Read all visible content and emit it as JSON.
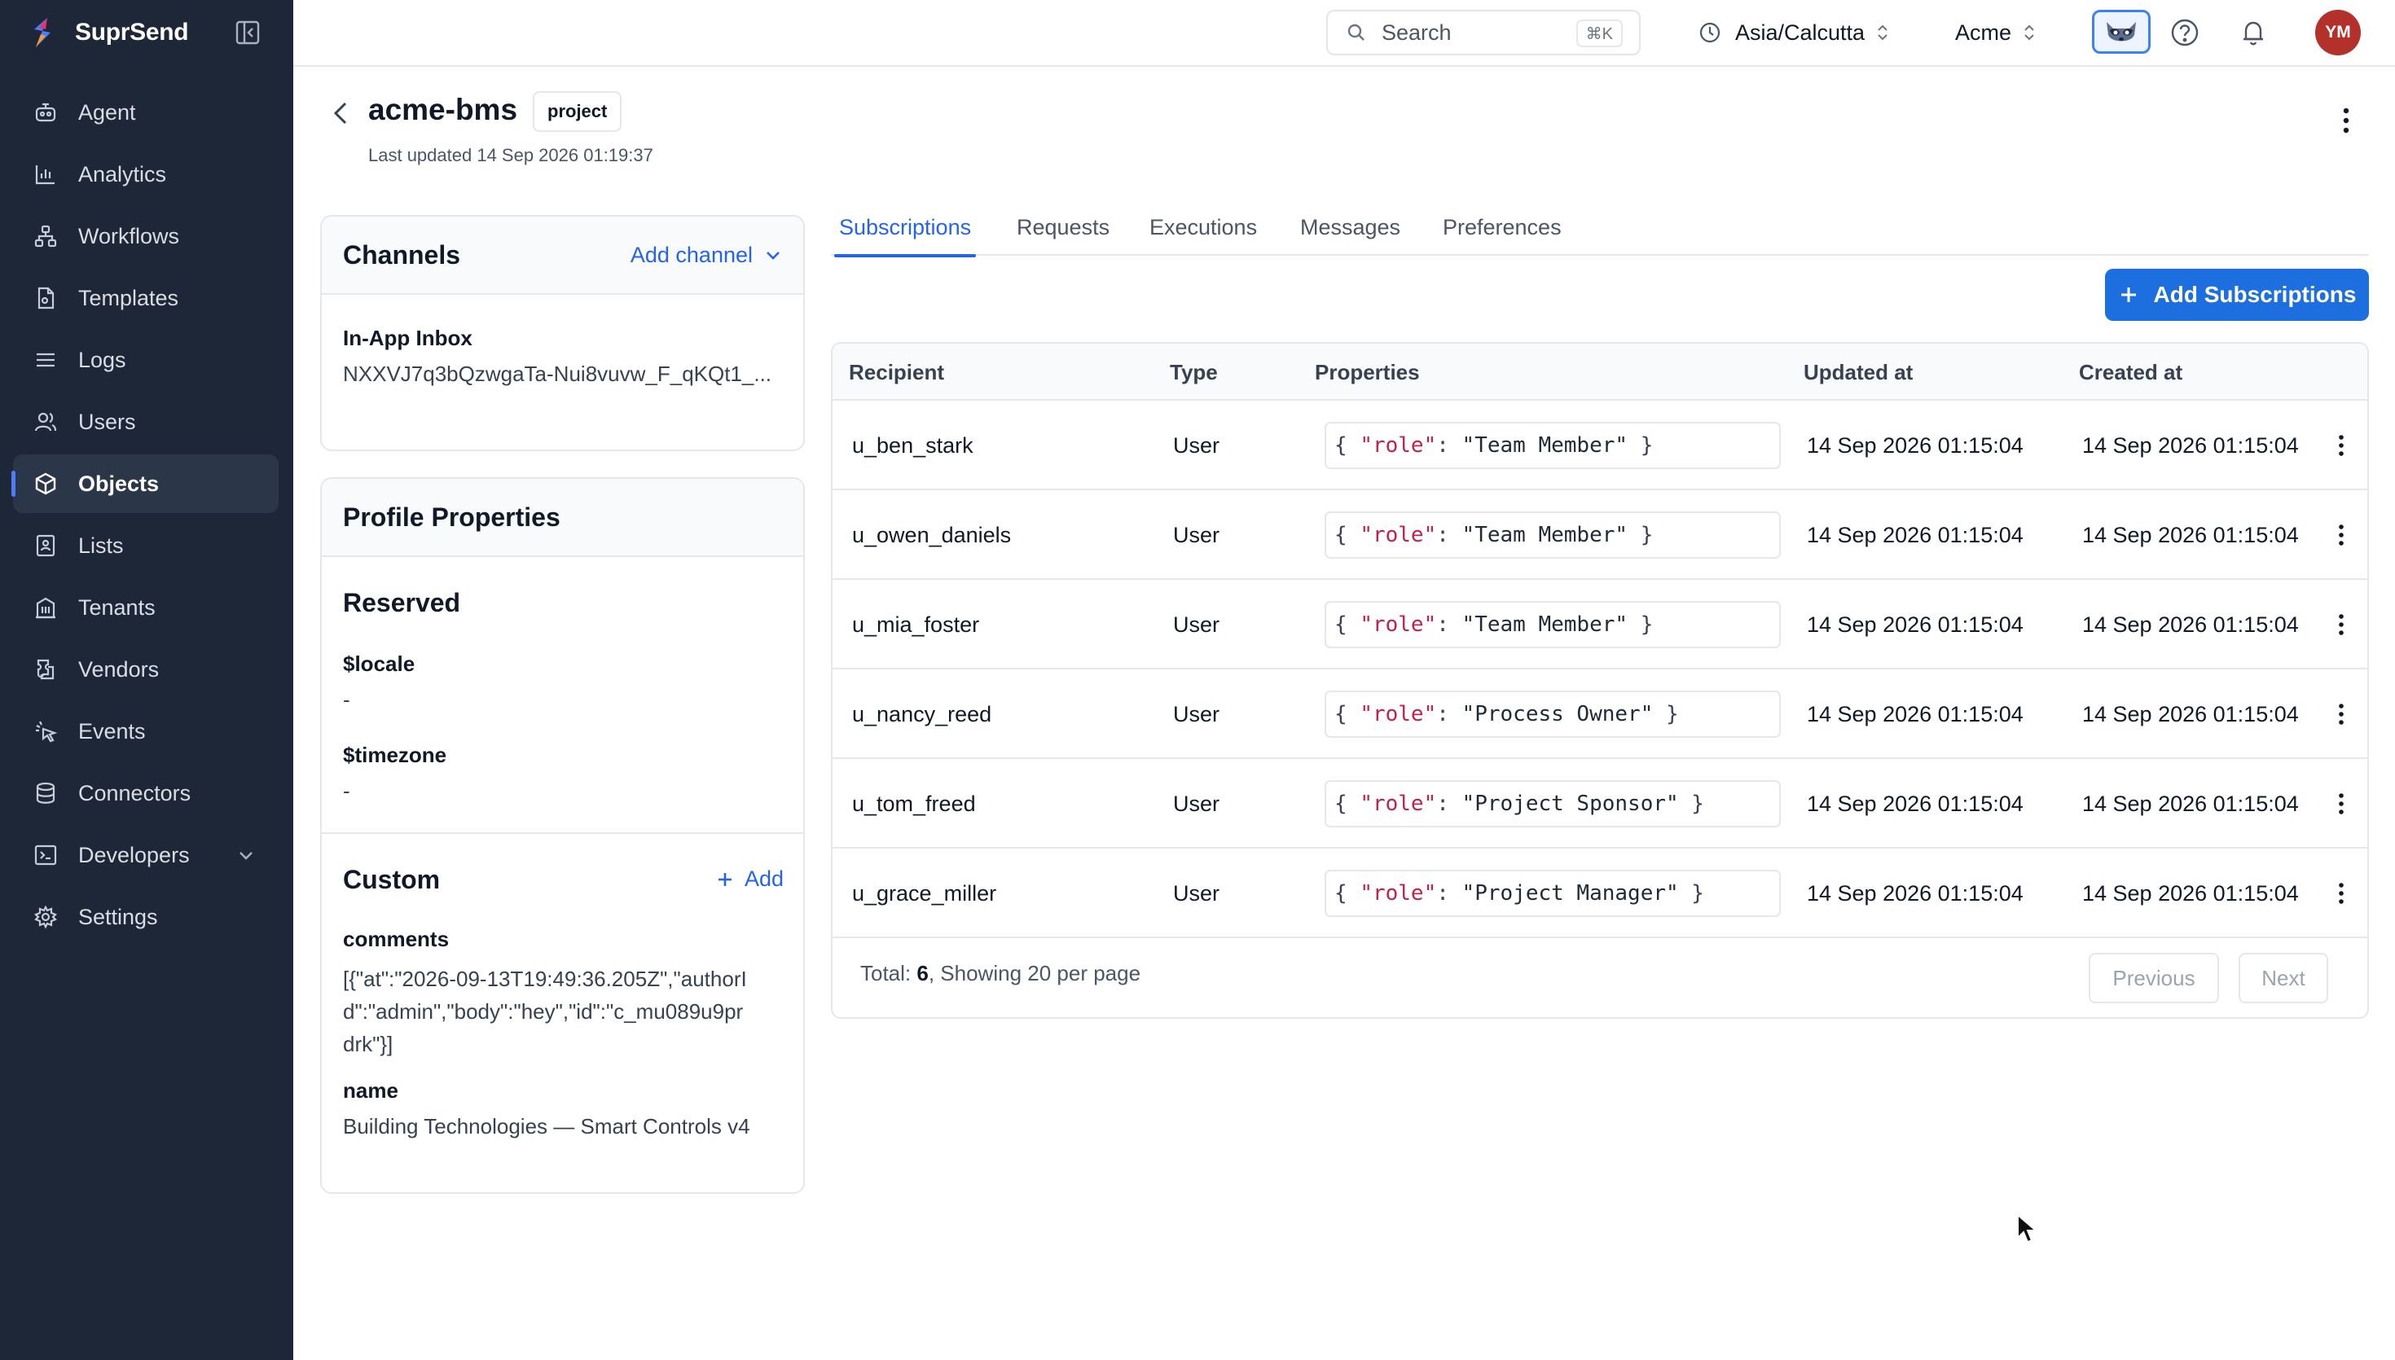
{
  "brand": {
    "name": "SuprSend"
  },
  "sidebar": {
    "items": [
      {
        "label": "Agent",
        "icon": "agent-icon"
      },
      {
        "label": "Analytics",
        "icon": "analytics-icon"
      },
      {
        "label": "Workflows",
        "icon": "workflows-icon"
      },
      {
        "label": "Templates",
        "icon": "templates-icon"
      },
      {
        "label": "Logs",
        "icon": "logs-icon"
      },
      {
        "label": "Users",
        "icon": "users-icon"
      },
      {
        "label": "Objects",
        "icon": "objects-icon",
        "active": true
      },
      {
        "label": "Lists",
        "icon": "lists-icon"
      },
      {
        "label": "Tenants",
        "icon": "tenants-icon"
      },
      {
        "label": "Vendors",
        "icon": "vendors-icon"
      },
      {
        "label": "Events",
        "icon": "events-icon"
      },
      {
        "label": "Connectors",
        "icon": "connectors-icon"
      },
      {
        "label": "Developers",
        "icon": "developers-icon",
        "expandable": true
      },
      {
        "label": "Settings",
        "icon": "settings-icon"
      }
    ]
  },
  "topbar": {
    "search_placeholder": "Search",
    "search_shortcut": "⌘K",
    "timezone": "Asia/Calcutta",
    "org": "Acme",
    "avatar_initials": "YM"
  },
  "header": {
    "title": "acme-bms",
    "badge": "project",
    "last_updated": "Last updated 14 Sep 2026 01:19:37"
  },
  "channels": {
    "title": "Channels",
    "add_label": "Add channel",
    "inbox_label": "In-App Inbox",
    "inbox_value": "NXXVJ7q3bQzwgaTa-Nui8vuvw_F_qKQt1_..."
  },
  "profile": {
    "title": "Profile Properties",
    "reserved_title": "Reserved",
    "locale_label": "$locale",
    "locale_value": "-",
    "timezone_label": "$timezone",
    "timezone_value": "-",
    "custom_title": "Custom",
    "add_label": "Add",
    "comments_label": "comments",
    "comments_line1": "[{\"at\":\"2026-09-13T19:49:36.205Z\",\"authorI",
    "comments_line2": "d\":\"admin\",\"body\":\"hey\",\"id\":\"c_mu089u9pr",
    "comments_line3": "drk\"}]",
    "name_label": "name",
    "name_value": "Building Technologies — Smart Controls v4"
  },
  "tabs": [
    "Subscriptions",
    "Requests",
    "Executions",
    "Messages",
    "Preferences"
  ],
  "add_subscriptions_label": "Add Subscriptions",
  "table": {
    "columns": [
      "Recipient",
      "Type",
      "Properties",
      "Updated at",
      "Created at"
    ],
    "rows": [
      {
        "recipient": "u_ben_stark",
        "type": "User",
        "prop_key": "\"role\"",
        "prop_value": "\"Team Member\"",
        "updated": "14 Sep 2026 01:15:04",
        "created": "14 Sep 2026 01:15:04"
      },
      {
        "recipient": "u_owen_daniels",
        "type": "User",
        "prop_key": "\"role\"",
        "prop_value": "\"Team Member\"",
        "updated": "14 Sep 2026 01:15:04",
        "created": "14 Sep 2026 01:15:04"
      },
      {
        "recipient": "u_mia_foster",
        "type": "User",
        "prop_key": "\"role\"",
        "prop_value": "\"Team Member\"",
        "updated": "14 Sep 2026 01:15:04",
        "created": "14 Sep 2026 01:15:04"
      },
      {
        "recipient": "u_nancy_reed",
        "type": "User",
        "prop_key": "\"role\"",
        "prop_value": "\"Process Owner\"",
        "updated": "14 Sep 2026 01:15:04",
        "created": "14 Sep 2026 01:15:04"
      },
      {
        "recipient": "u_tom_freed",
        "type": "User",
        "prop_key": "\"role\"",
        "prop_value": "\"Project Sponsor\"",
        "updated": "14 Sep 2026 01:15:04",
        "created": "14 Sep 2026 01:15:04"
      },
      {
        "recipient": "u_grace_miller",
        "type": "User",
        "prop_key": "\"role\"",
        "prop_value": "\"Project Manager\"",
        "updated": "14 Sep 2026 01:15:04",
        "created": "14 Sep 2026 01:15:04"
      }
    ],
    "total_prefix": "Total: ",
    "total_count": "6",
    "total_suffix": ", Showing 20 per page",
    "prev_label": "Previous",
    "next_label": "Next"
  },
  "colors": {
    "sidebar_bg": "#1e2738",
    "accent": "#2563eb",
    "avatar_bg": "#b3302b",
    "json_key": "#c4204b"
  }
}
